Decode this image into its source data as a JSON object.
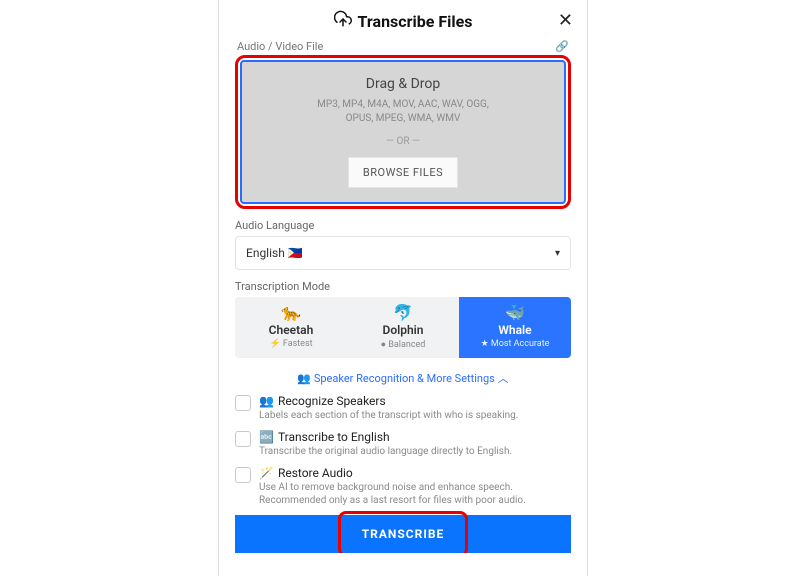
{
  "header": {
    "title": "Transcribe Files"
  },
  "upload": {
    "field_label": "Audio / Video File",
    "drag_title": "Drag & Drop",
    "formats_line1": "MP3, MP4, M4A, MOV, AAC, WAV, OGG,",
    "formats_line2": "OPUS, MPEG, WMA, WMV",
    "or": "— OR —",
    "browse": "BROWSE FILES"
  },
  "language": {
    "label": "Audio Language",
    "value": "English 🇵🇭"
  },
  "modes": {
    "label": "Transcription Mode",
    "items": [
      {
        "emoji": "🐆",
        "name": "Cheetah",
        "sub": "⚡ Fastest"
      },
      {
        "emoji": "🐬",
        "name": "Dolphin",
        "sub": "● Balanced"
      },
      {
        "emoji": "🐳",
        "name": "Whale",
        "sub": "★ Most Accurate"
      }
    ]
  },
  "settings": {
    "toggle": "👥 Speaker Recognition & More Settings ︿",
    "options": [
      {
        "emoji": "👥",
        "title": "Recognize Speakers",
        "desc": "Labels each section of the transcript with who is speaking."
      },
      {
        "emoji": "🔤",
        "title": "Transcribe to English",
        "desc": "Transcribe the original audio language directly to English."
      },
      {
        "emoji": "🪄",
        "title": "Restore Audio",
        "desc": "Use AI to remove background noise and enhance speech. Recommended only as a last resort for files with poor audio."
      }
    ]
  },
  "cta": "TRANSCRIBE"
}
